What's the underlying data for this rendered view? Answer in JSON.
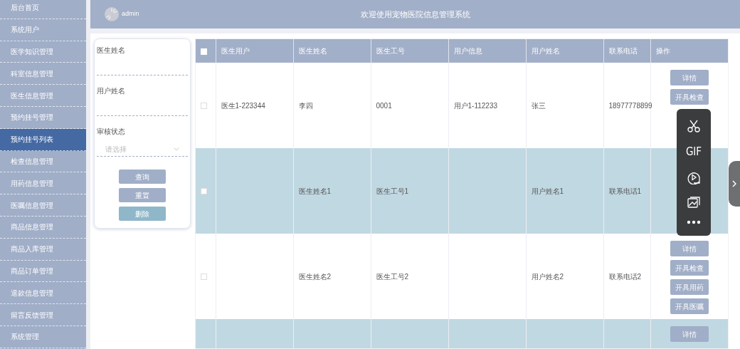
{
  "sidebar": {
    "items": [
      {
        "label": "后台首页",
        "selected": false
      },
      {
        "label": "系统用户",
        "selected": false
      },
      {
        "label": "医学知识管理",
        "selected": false
      },
      {
        "label": "科室信息管理",
        "selected": false
      },
      {
        "label": "医生信息管理",
        "selected": false
      },
      {
        "label": "预约挂号管理",
        "selected": false
      },
      {
        "label": "预约挂号列表",
        "selected": true
      },
      {
        "label": "检查信息管理",
        "selected": false
      },
      {
        "label": "用药信息管理",
        "selected": false
      },
      {
        "label": "医嘱信息管理",
        "selected": false
      },
      {
        "label": "商品信息管理",
        "selected": false
      },
      {
        "label": "商品入库管理",
        "selected": false
      },
      {
        "label": "商品订单管理",
        "selected": false
      },
      {
        "label": "退款信息管理",
        "selected": false
      },
      {
        "label": "留言反馈管理",
        "selected": false
      },
      {
        "label": "系统管理",
        "selected": false
      }
    ]
  },
  "header": {
    "user": "admin",
    "title": "欢迎使用宠物医院信息管理系统"
  },
  "search": {
    "fields": [
      {
        "kind": "text",
        "label": "医生姓名"
      },
      {
        "kind": "text",
        "label": "用户姓名"
      },
      {
        "kind": "select",
        "label": "审核状态",
        "placeholder": "请选择"
      }
    ],
    "buttons": [
      {
        "label": "查询",
        "disabled": false
      },
      {
        "label": "重置",
        "disabled": false
      },
      {
        "label": "删除",
        "disabled": true
      }
    ]
  },
  "table": {
    "all_checked": false,
    "columns": [
      "医生用户",
      "医生姓名",
      "医生工号",
      "用户信息",
      "用户姓名",
      "联系电话",
      "操作"
    ],
    "rows": [
      {
        "cells": [
          "医生1-223344",
          "李四",
          "0001",
          "用户1-112233",
          "张三",
          "18977778899"
        ],
        "actions": [
          "详情",
          "开具检查"
        ],
        "checked": false
      },
      {
        "cells": [
          null,
          "医生姓名1",
          "医生工号1",
          null,
          "用户姓名1",
          "联系电话1"
        ],
        "checked": false
      },
      {
        "cells": [
          null,
          "医生姓名2",
          "医生工号2",
          null,
          "用户姓名2",
          "联系电话2"
        ],
        "actions": [
          "详情",
          "开具检查",
          "开具用药",
          "开具医嘱"
        ],
        "checked": false
      },
      {
        "cells": [
          null,
          null,
          null,
          null,
          null,
          null
        ],
        "actions": [
          "详情"
        ]
      }
    ]
  },
  "capture_toolbar": {
    "gif_label": "GIF"
  }
}
